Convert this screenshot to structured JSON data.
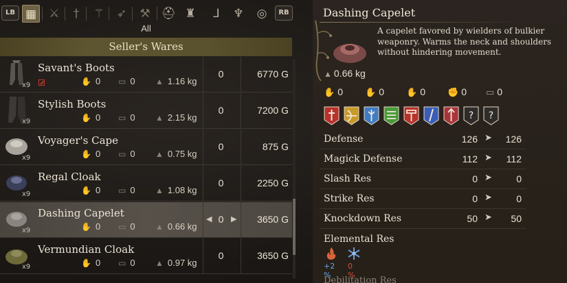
{
  "tabs": {
    "lb": "LB",
    "rb": "RB",
    "icons": [
      "all-items-icon",
      "sword-icon",
      "dagger-icon",
      "staff-icon",
      "bow-icon",
      "mace-icon",
      "shield-icon",
      "helmet-icon",
      "chest-armor-icon",
      "boots-icon",
      "cloak-icon",
      "ring-icon"
    ],
    "category": "All"
  },
  "seller": {
    "header": "Seller's Wares"
  },
  "items": [
    {
      "name": "Savant's Boots",
      "qty": "x9",
      "stat1": "0",
      "stat2": "0",
      "weight": "1.16 kg",
      "owned": "0",
      "price": "6770 G",
      "unusable": true
    },
    {
      "name": "Stylish Boots",
      "qty": "x9",
      "stat1": "0",
      "stat2": "0",
      "weight": "2.15 kg",
      "owned": "0",
      "price": "7200 G"
    },
    {
      "name": "Voyager's Cape",
      "qty": "x9",
      "stat1": "0",
      "stat2": "0",
      "weight": "0.75 kg",
      "owned": "0",
      "price": "875 G"
    },
    {
      "name": "Regal Cloak",
      "qty": "x9",
      "stat1": "0",
      "stat2": "0",
      "weight": "1.08 kg",
      "owned": "0",
      "price": "2250 G"
    },
    {
      "name": "Dashing Capelet",
      "qty": "x9",
      "stat1": "0",
      "stat2": "0",
      "weight": "0.66 kg",
      "owned": "0",
      "price": "3650 G",
      "selected": true
    },
    {
      "name": "Vermundian Cloak",
      "qty": "x9",
      "stat1": "0",
      "stat2": "0",
      "weight": "0.97 kg",
      "owned": "0",
      "price": "3650 G"
    }
  ],
  "detail": {
    "title": "Dashing Capelet",
    "description": "A capelet favored by wielders of bulkier weaponry. Warms the neck and shoulders without hindering movement.",
    "weight": "0.66 kg",
    "small_stats": [
      "0",
      "0",
      "0",
      "0",
      "0"
    ],
    "small_stat_icons": [
      "red-hand-icon",
      "blue-hand-icon",
      "grey-hand-icon",
      "fist-icon",
      "chest-icon"
    ],
    "augment_icons": [
      "fighter-vocation-icon",
      "archer-vocation-icon",
      "mage-vocation-icon",
      "thief-vocation-icon",
      "warrior-vocation-icon",
      "sorcerer-vocation-icon",
      "mystic-spearhand-vocation-icon",
      "unknown-vocation-icon",
      "unknown-vocation-icon"
    ],
    "augment_colors": [
      "#b8322c",
      "#c89a2a",
      "#3f7cc4",
      "#4a9a3c",
      "#b8322c",
      "#3a5db8",
      "#a8343a",
      "#3a3a3a",
      "#3a3a3a"
    ],
    "stats": [
      {
        "label": "Defense",
        "current": "126",
        "new": "126"
      },
      {
        "label": "Magick Defense",
        "current": "112",
        "new": "112"
      },
      {
        "label": "Slash Res",
        "current": "0",
        "new": "0"
      },
      {
        "label": "Strike Res",
        "current": "0",
        "new": "0"
      },
      {
        "label": "Knockdown Res",
        "current": "50",
        "new": "50"
      }
    ],
    "elemental_label": "Elemental Res",
    "elemental": [
      {
        "icon": "fire-icon",
        "value": "+2 %",
        "color": "#6aa3e8"
      },
      {
        "icon": "ice-icon",
        "value": "0 %",
        "color": "#d94a3e"
      }
    ],
    "cut_label": "Debilitation Res"
  },
  "colors": {
    "accent_gold": "#8d7d5a",
    "header_band": "#5d5530",
    "selected_row": "#57514a"
  }
}
